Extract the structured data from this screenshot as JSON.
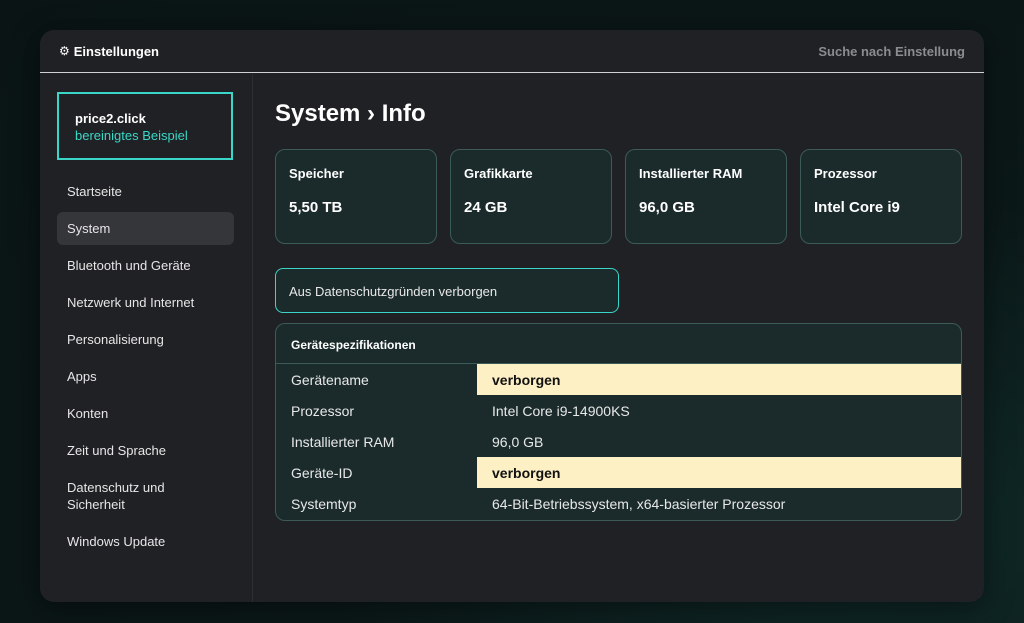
{
  "window": {
    "title": "Einstellungen",
    "search_label": "Suche nach Einstellung"
  },
  "account": {
    "name": "price2.click",
    "subtitle": "bereinigtes Beispiel"
  },
  "sidebar": {
    "items": [
      {
        "label": "Startseite"
      },
      {
        "label": "System",
        "active": true
      },
      {
        "label": "Bluetooth und Geräte"
      },
      {
        "label": "Netzwerk und Internet"
      },
      {
        "label": "Personalisierung"
      },
      {
        "label": "Apps"
      },
      {
        "label": "Konten"
      },
      {
        "label": "Zeit und Sprache"
      },
      {
        "label": "Datenschutz und Sicherheit"
      },
      {
        "label": "Windows Update"
      }
    ]
  },
  "main": {
    "title": "System › Info",
    "cards": [
      {
        "label": "Speicher",
        "value": "5,50 TB"
      },
      {
        "label": "Grafikkarte",
        "value": "24 GB"
      },
      {
        "label": "Installierter RAM",
        "value": "96,0 GB"
      },
      {
        "label": "Prozessor",
        "value": "Intel Core i9"
      }
    ],
    "notice": "Aus Datenschutzgründen verborgen",
    "specs": {
      "title": "Gerätespezifikationen",
      "rows": [
        {
          "key": "Gerätename",
          "value": "verborgen",
          "hidden": true
        },
        {
          "key": "Prozessor",
          "value": "Intel Core i9-14900KS"
        },
        {
          "key": "Installierter RAM",
          "value": "96,0 GB"
        },
        {
          "key": "Geräte-ID",
          "value": "verborgen",
          "hidden": true
        },
        {
          "key": "Systemtyp",
          "value": "64-Bit-Betriebssystem, x64-basierter Prozessor"
        }
      ]
    }
  },
  "colors": {
    "accent": "#3ad6c7",
    "window_bg": "#202124",
    "card_bg": "#1b2b2b",
    "highlight": "#fef0c5"
  }
}
